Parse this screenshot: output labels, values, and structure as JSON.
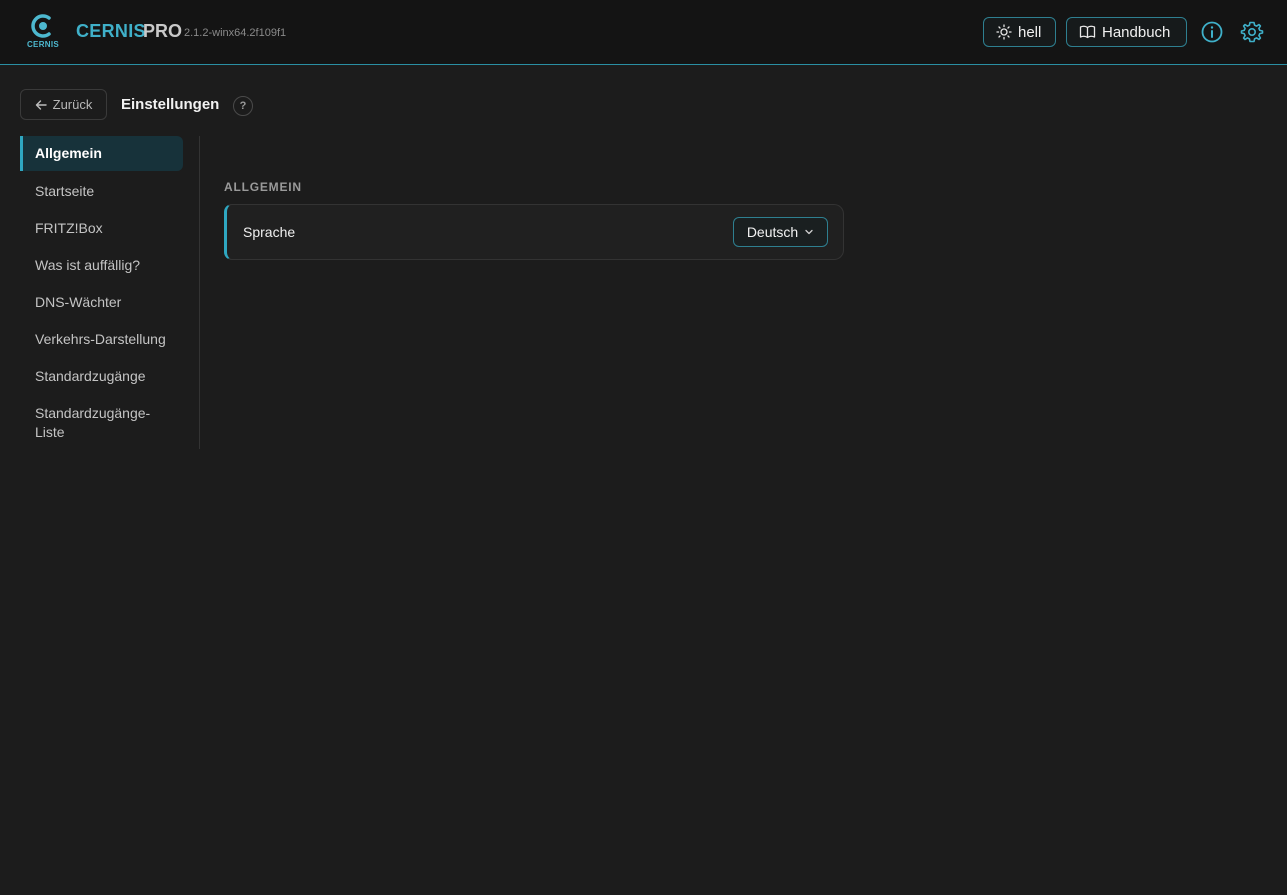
{
  "header": {
    "logo_text": "CERNIS",
    "brand": "CERNIS",
    "brand_suffix": "PRO",
    "version": "2.1.2-winx64.2f109f1",
    "theme_button": "hell",
    "manual_button": "Handbuch",
    "icons": {
      "info": "info-icon",
      "settings": "gear-icon",
      "theme": "sun-icon",
      "manual": "book-icon"
    },
    "accent_color": "#3fb0c9"
  },
  "toolbar": {
    "back_label": "Zurück",
    "title": "Einstellungen",
    "help_label": "?"
  },
  "sidebar": {
    "items": [
      {
        "label": "Allgemein",
        "active": true
      },
      {
        "label": "Startseite"
      },
      {
        "label": "FRITZ!Box"
      },
      {
        "label": "Was ist auffällig?"
      },
      {
        "label": "DNS-Wächter"
      },
      {
        "label": "Verkehrs-Darstellung"
      },
      {
        "label": "Standardzugänge"
      },
      {
        "label": "Standardzugänge-\nListe"
      }
    ]
  },
  "main": {
    "section_heading": "ALLGEMEIN",
    "settings": [
      {
        "label": "Sprache",
        "value": "Deutsch"
      }
    ]
  }
}
